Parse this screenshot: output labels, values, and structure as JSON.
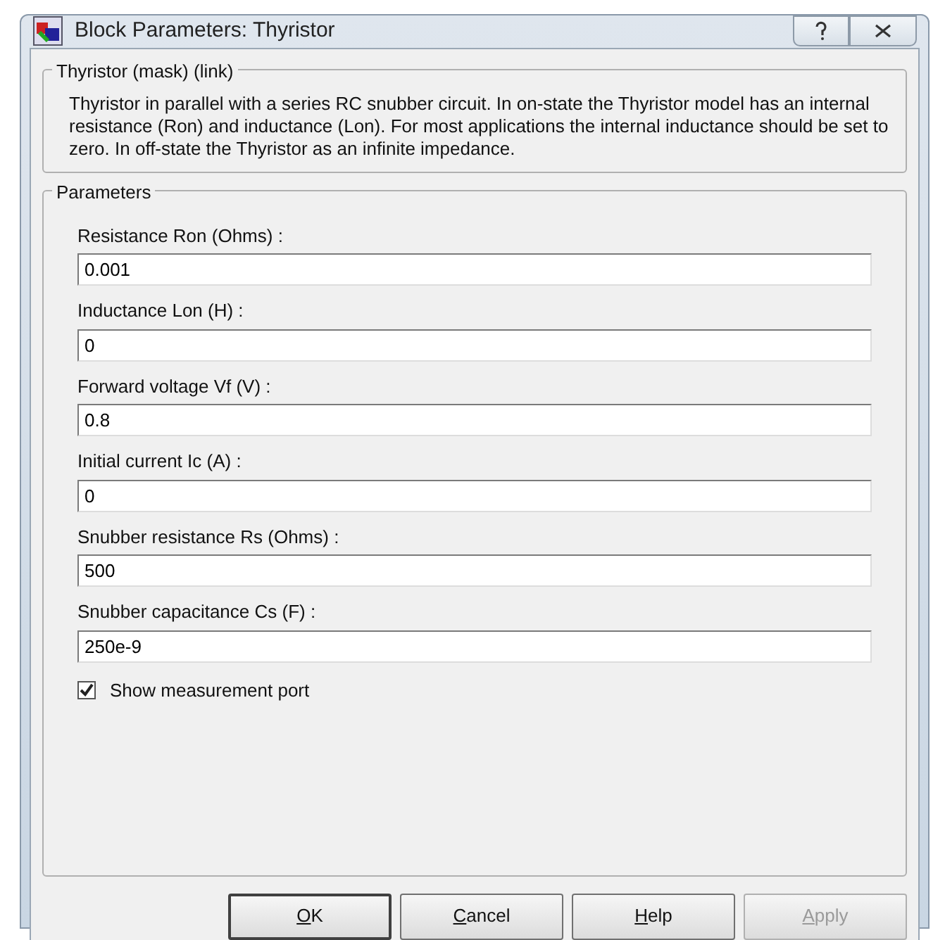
{
  "window": {
    "title": "Block Parameters: Thyristor"
  },
  "mask_group": {
    "title": "Thyristor (mask) (link)",
    "description": "Thyristor in parallel with a series RC snubber circuit. In on-state the Thyristor model has an internal resistance (Ron) and inductance (Lon).  For most applications the internal inductance should be set to zero. In off-state the Thyristor as an infinite impedance."
  },
  "parameters": {
    "title": "Parameters",
    "fields": [
      {
        "label": "Resistance Ron (Ohms) :",
        "value": "0.001"
      },
      {
        "label": "Inductance Lon (H) :",
        "value": "0"
      },
      {
        "label": "Forward voltage Vf (V) :",
        "value": "0.8"
      },
      {
        "label": "Initial current Ic (A) :",
        "value": "0"
      },
      {
        "label": "Snubber resistance Rs (Ohms) :",
        "value": "500"
      },
      {
        "label": "Snubber capacitance Cs (F) :",
        "value": "250e-9"
      }
    ],
    "checkbox": {
      "label": "Show measurement port",
      "checked": true
    }
  },
  "buttons": [
    {
      "label": "OK",
      "disabled": false,
      "default": true
    },
    {
      "label": "Cancel",
      "disabled": false,
      "default": false
    },
    {
      "label": "Help",
      "disabled": false,
      "default": false
    },
    {
      "label": "Apply",
      "disabled": true,
      "default": false
    }
  ]
}
